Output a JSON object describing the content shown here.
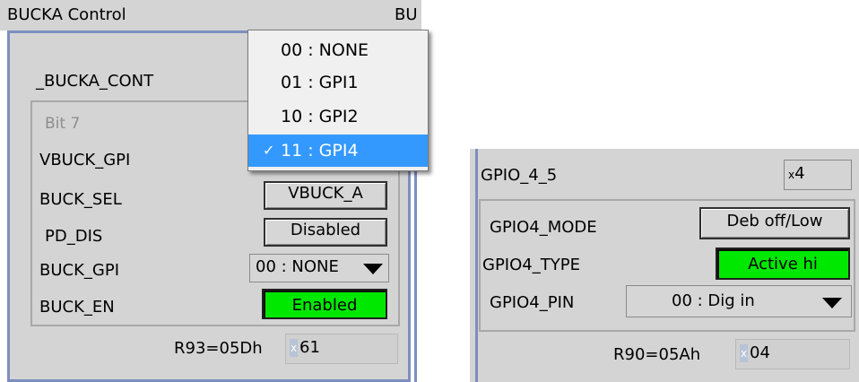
{
  "left_panel": {
    "title": "BUCKA Control",
    "partial_title": "BU",
    "group_label": "_BUCKA_CONT",
    "bit_label": "Bit 7",
    "rows": [
      {
        "label": "VBUCK_GPI"
      },
      {
        "label": "BUCK_SEL",
        "control": "VBUCK_A"
      },
      {
        "label": "PD_DIS",
        "control": "Disabled"
      },
      {
        "label": "BUCK_GPI",
        "control": "00 : NONE"
      },
      {
        "label": "BUCK_EN",
        "control": "Enabled"
      }
    ],
    "register_label": "R93=05Dh",
    "register_prefix": "x",
    "register_value": "61"
  },
  "dropdown": {
    "items": [
      "00 : NONE",
      "01 : GPI1",
      "10 : GPI2",
      "11 : GPI4"
    ],
    "selected_index": 3,
    "check": "✓"
  },
  "right_panel": {
    "group_label": "GPIO_4_5",
    "group_prefix": "x",
    "group_value": "4",
    "rows": [
      {
        "label": "GPIO4_MODE",
        "control": "Deb off/Low"
      },
      {
        "label": "GPIO4_TYPE",
        "control": "Active hi"
      },
      {
        "label": "GPIO4_PIN",
        "control": "00 : Dig in"
      }
    ],
    "register_label": "R90=05Ah",
    "register_prefix": "x",
    "register_value": "04"
  },
  "colors": {
    "panel_bg": "#d4d4d4",
    "frame_blue": "#7b8fbf",
    "active_green": "#00e800",
    "menu_highlight": "#3399ff"
  }
}
